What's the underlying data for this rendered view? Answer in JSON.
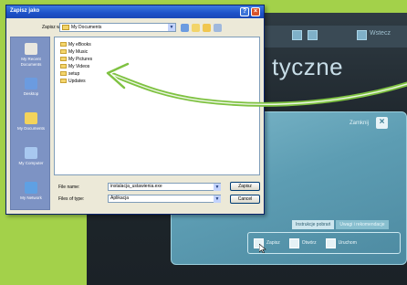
{
  "app": {
    "wstecz_label": "Wstecz",
    "heading": "tyczne",
    "close_label": "Zamknij",
    "tabs": [
      "Instrukcje pobrań",
      "Uwagi i rekomendacje"
    ],
    "buttons": [
      "Zapisz",
      "Otwórz",
      "Uruchom"
    ]
  },
  "dialog": {
    "title": "Zapisz jako",
    "look_in_label": "Zapisz w:",
    "look_in_value": "My Documents",
    "places": [
      {
        "label": "My Recent Documents",
        "icon": "recent-documents-icon",
        "color": "#e9e7df"
      },
      {
        "label": "Desktop",
        "icon": "desktop-icon",
        "color": "#6b9be0"
      },
      {
        "label": "My Documents",
        "icon": "my-documents-icon",
        "color": "#f3d35b"
      },
      {
        "label": "My Computer",
        "icon": "my-computer-icon",
        "color": "#a8c8f0"
      },
      {
        "label": "My Network",
        "icon": "my-network-icon",
        "color": "#5fa0e3"
      }
    ],
    "files": [
      "My eBooks",
      "My Music",
      "My Pictures",
      "My Videos",
      "setup",
      "Updates"
    ],
    "file_name_label": "File name:",
    "file_name_value": "instalacja_ustawienia.exe",
    "file_type_label": "Files of type:",
    "file_type_value": "Aplikacja",
    "save_button": "Zapisz",
    "cancel_button": "Cancel"
  },
  "colors": {
    "accent_green": "#8cc63f",
    "titlebar_blue": "#1d52c8",
    "panel_teal": "#5d9db3"
  }
}
